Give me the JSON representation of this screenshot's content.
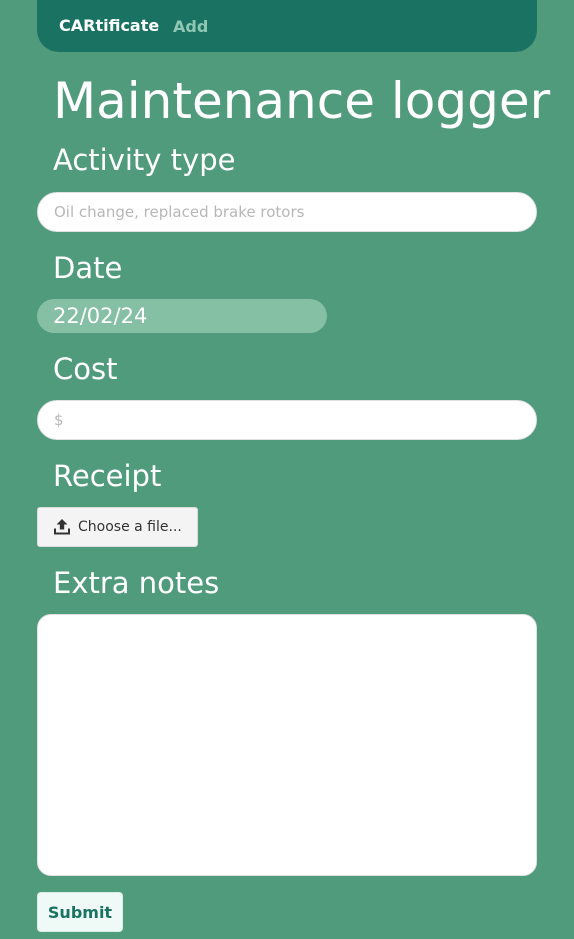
{
  "navbar": {
    "brand": "CARtificate",
    "add_link": "Add"
  },
  "page": {
    "title": "Maintenance logger"
  },
  "form": {
    "activity_type": {
      "label": "Activity type",
      "placeholder": "Oil change, replaced brake rotors",
      "value": ""
    },
    "date": {
      "label": "Date",
      "value": "22/02/24"
    },
    "cost": {
      "label": "Cost",
      "placeholder": "$",
      "value": ""
    },
    "receipt": {
      "label": "Receipt",
      "button_label": "Choose a file...",
      "icon": "upload-icon"
    },
    "extra_notes": {
      "label": "Extra notes",
      "value": ""
    },
    "submit_label": "Submit"
  },
  "colors": {
    "background": "#519b7d",
    "navbar": "#1a7362",
    "nav_inactive": "#8fc7b3",
    "date_pill": "#85bfa4",
    "submit_text": "#1a7362"
  }
}
